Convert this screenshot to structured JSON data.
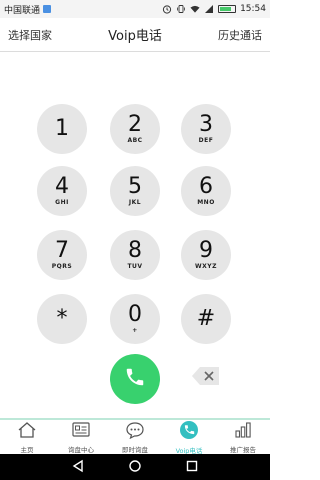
{
  "status_bar": {
    "carrier": "中国联通",
    "time": "15:54",
    "battery_level": 0.8
  },
  "header": {
    "left": "选择国家",
    "title": "Voip电话",
    "right": "历史通话"
  },
  "keypad": [
    {
      "digit": "1",
      "letters": ""
    },
    {
      "digit": "2",
      "letters": "ABC"
    },
    {
      "digit": "3",
      "letters": "DEF"
    },
    {
      "digit": "4",
      "letters": "GHI"
    },
    {
      "digit": "5",
      "letters": "JKL"
    },
    {
      "digit": "6",
      "letters": "MNO"
    },
    {
      "digit": "7",
      "letters": "PQRS"
    },
    {
      "digit": "8",
      "letters": "TUV"
    },
    {
      "digit": "9",
      "letters": "WXYZ"
    },
    {
      "digit": "*",
      "letters": ""
    },
    {
      "digit": "0",
      "letters": "+"
    },
    {
      "digit": "#",
      "letters": ""
    }
  ],
  "tabs": [
    {
      "label": "主页",
      "icon": "home-icon"
    },
    {
      "label": "询盘中心",
      "icon": "inquiry-card-icon"
    },
    {
      "label": "即时询盘",
      "icon": "chat-bubble-icon"
    },
    {
      "label": "Voip电话",
      "icon": "phone-icon",
      "active": true
    },
    {
      "label": "推广报告",
      "icon": "bar-chart-icon"
    }
  ],
  "colors": {
    "call_green": "#38d16e",
    "accent_teal": "#33bfc0",
    "key_gray": "#e6e6e6"
  }
}
